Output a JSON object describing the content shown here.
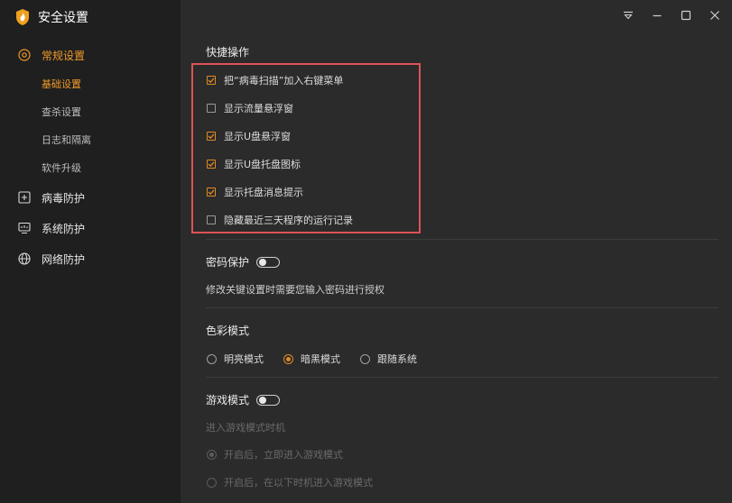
{
  "app": {
    "title": "安全设置"
  },
  "sidebar": {
    "groups": [
      {
        "label": "常规设置",
        "icon": "gear-circle-icon",
        "active": true,
        "subitems": [
          {
            "label": "基础设置",
            "active": true
          },
          {
            "label": "查杀设置"
          },
          {
            "label": "日志和隔离"
          },
          {
            "label": "软件升级"
          }
        ]
      },
      {
        "label": "病毒防护",
        "icon": "plus-square-icon"
      },
      {
        "label": "系统防护",
        "icon": "monitor-icon"
      },
      {
        "label": "网络防护",
        "icon": "globe-icon"
      }
    ]
  },
  "window_controls": [
    "menu-icon",
    "minimize-icon",
    "maximize-icon",
    "close-icon"
  ],
  "quick_ops": {
    "title": "快捷操作",
    "items": [
      {
        "label": "把“病毒扫描”加入右键菜单",
        "checked": true
      },
      {
        "label": "显示流量悬浮窗",
        "checked": false
      },
      {
        "label": "显示U盘悬浮窗",
        "checked": true
      },
      {
        "label": "显示U盘托盘图标",
        "checked": true
      },
      {
        "label": "显示托盘消息提示",
        "checked": true
      },
      {
        "label": "隐藏最近三天程序的运行记录",
        "checked": false
      }
    ]
  },
  "password": {
    "label": "密码保护",
    "enabled": false,
    "description": "修改关键设置时需要您输入密码进行授权"
  },
  "color_mode": {
    "title": "色彩模式",
    "options": [
      {
        "label": "明亮模式",
        "selected": false
      },
      {
        "label": "暗黑模式",
        "selected": true
      },
      {
        "label": "跟随系统",
        "selected": false
      }
    ]
  },
  "game_mode": {
    "label": "游戏模式",
    "enabled": false,
    "sub_label": "进入游戏模式时机",
    "options": [
      {
        "label": "开启后，立即进入游戏模式",
        "selected": true
      },
      {
        "label": "开启后，在以下时机进入游戏模式",
        "selected": false
      }
    ]
  },
  "colors": {
    "accent": "#f09a2a",
    "highlight_border": "#e05254",
    "sidebar_bg": "#1f1f1f",
    "main_bg": "#2b2b2b"
  }
}
